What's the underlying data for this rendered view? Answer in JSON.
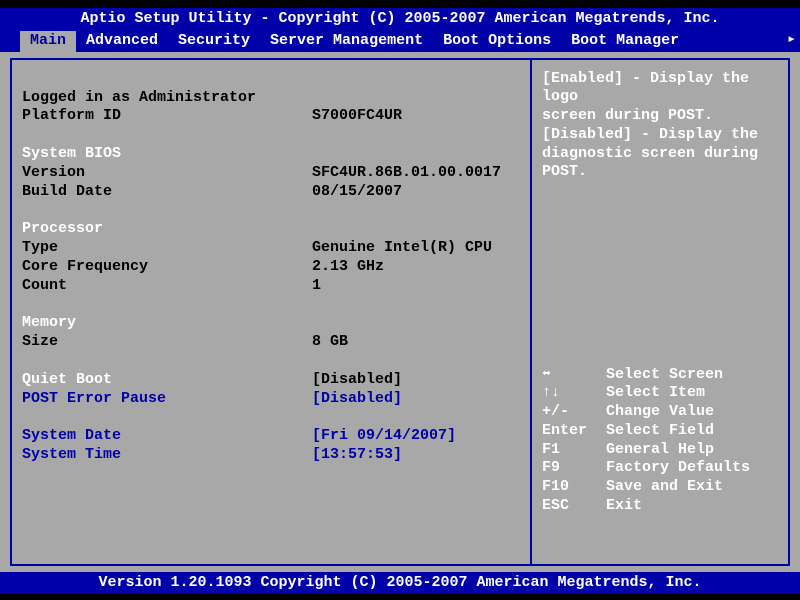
{
  "title": "Aptio Setup Utility - Copyright (C) 2005-2007 American Megatrends, Inc.",
  "menu": {
    "items": [
      "Main",
      "Advanced",
      "Security",
      "Server Management",
      "Boot Options",
      "Boot Manager"
    ],
    "selected": 0,
    "arrow": "▸"
  },
  "main": {
    "logged_in": "Logged in as Administrator",
    "platform_id_label": "Platform ID",
    "platform_id_value": "S7000FC4UR",
    "bios_header": "System BIOS",
    "version_label": "Version",
    "version_value": "SFC4UR.86B.01.00.0017",
    "build_date_label": "Build Date",
    "build_date_value": "08/15/2007",
    "processor_header": "Processor",
    "type_label": "Type",
    "type_value": "Genuine Intel(R) CPU",
    "freq_label": "Core Frequency",
    "freq_value": "2.13 GHz",
    "count_label": "Count",
    "count_value": "1",
    "memory_header": "Memory",
    "size_label": "Size",
    "size_value": "8 GB",
    "quiet_boot_label": "Quiet Boot",
    "quiet_boot_value": "[Disabled]",
    "post_error_label": "POST Error Pause",
    "post_error_value": "[Disabled]",
    "date_label": "System Date",
    "date_value": "[Fri 09/14/2007]",
    "time_label": "System Time",
    "time_value": "[13:57:53]"
  },
  "help": {
    "line1": "[Enabled] - Display the logo",
    "line2": "screen during POST.",
    "line3": "[Disabled] - Display the",
    "line4": "diagnostic screen during POST."
  },
  "keys": [
    {
      "k": "⬌",
      "d": "Select Screen"
    },
    {
      "k": "↑↓",
      "d": "Select Item"
    },
    {
      "k": "+/-",
      "d": "Change Value"
    },
    {
      "k": "Enter",
      "d": "Select Field"
    },
    {
      "k": "F1",
      "d": "General Help"
    },
    {
      "k": "F9",
      "d": "Factory Defaults"
    },
    {
      "k": "F10",
      "d": "Save and Exit"
    },
    {
      "k": "ESC",
      "d": "Exit"
    }
  ],
  "footer": "Version 1.20.1093 Copyright (C) 2005-2007 American Megatrends, Inc."
}
